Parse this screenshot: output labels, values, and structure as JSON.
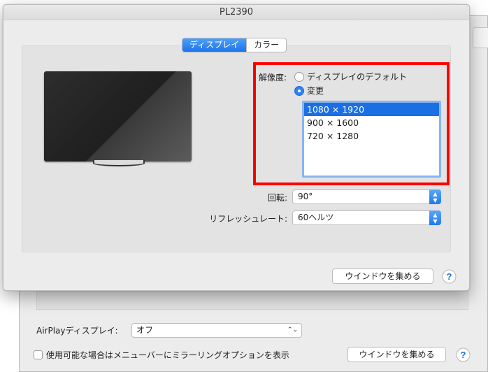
{
  "background_window": {
    "airplay_label": "AirPlayディスプレイ:",
    "airplay_value": "オフ",
    "mirror_option_label": "使用可能な場合はメニューバーにミラーリングオプションを表示",
    "gather_windows_label": "ウインドウを集める",
    "help_label": "?"
  },
  "window": {
    "title": "PL2390",
    "tabs": [
      {
        "label": "ディスプレイ",
        "active": true
      },
      {
        "label": "カラー",
        "active": false
      }
    ],
    "resolution": {
      "label": "解像度:",
      "options": [
        {
          "label": "ディスプレイのデフォルト",
          "selected": false
        },
        {
          "label": "変更",
          "selected": true
        }
      ],
      "list": [
        "1080 × 1920",
        "900 × 1600",
        "720 × 1280"
      ],
      "selected_index": 0
    },
    "rotation": {
      "label": "回転:",
      "value": "90°"
    },
    "refresh_rate": {
      "label": "リフレッシュレート:",
      "value": "60ヘルツ"
    },
    "gather_windows_label": "ウインドウを集める",
    "help_label": "?"
  },
  "colors": {
    "accent": "#1a6fe3",
    "highlight_border": "#ff0000"
  },
  "icons": {
    "updown": "chevron-updown-icon",
    "help": "help-icon",
    "monitor": "monitor-icon"
  }
}
